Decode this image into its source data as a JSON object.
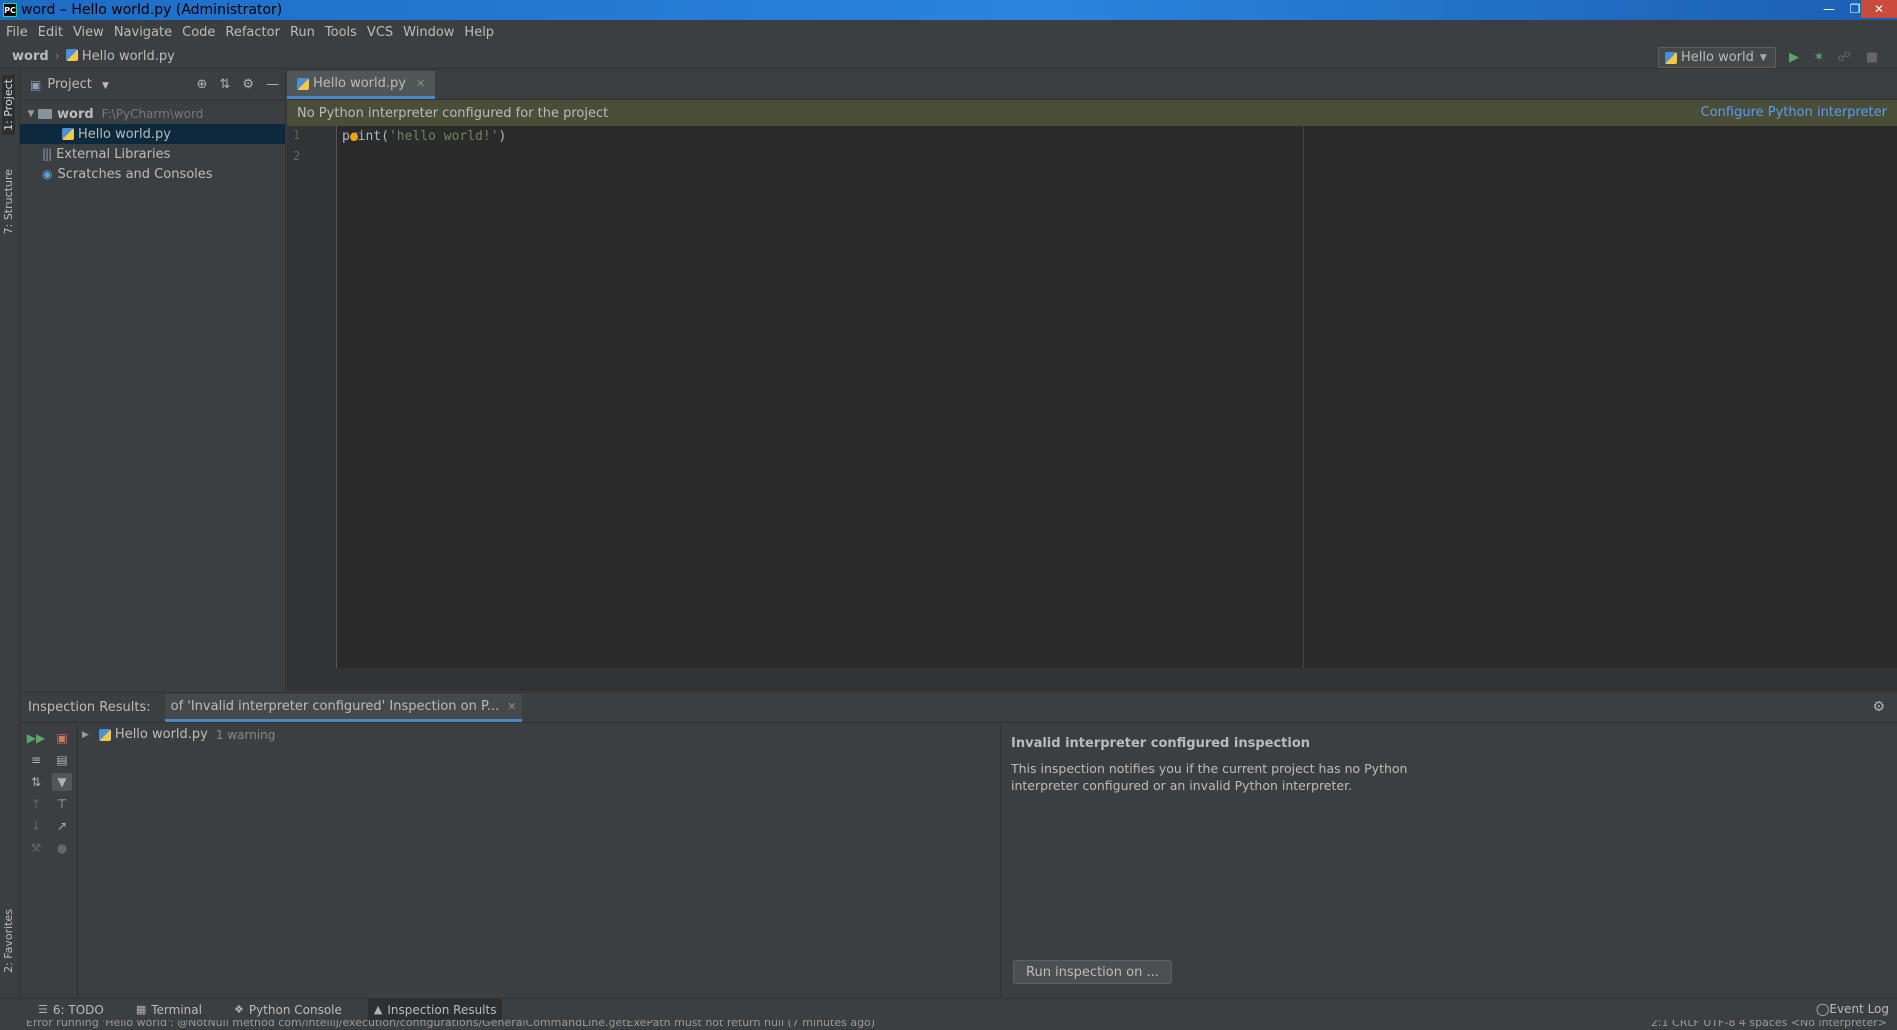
{
  "window": {
    "title": "word – Hello world.py (Administrator)",
    "app_icon": "PC"
  },
  "menu": [
    "File",
    "Edit",
    "View",
    "Navigate",
    "Code",
    "Refactor",
    "Run",
    "Tools",
    "VCS",
    "Window",
    "Help"
  ],
  "navbar": {
    "root": "word",
    "file": "Hello world.py"
  },
  "run_config": {
    "label": "Hello world"
  },
  "left_strip": {
    "project_tab": "1: Project",
    "structure_tab": "7: Structure",
    "favorites_tab": "2: Favorites"
  },
  "project_panel": {
    "title": "Project",
    "root_name": "word",
    "root_path": "F:\\PyCharm\\word",
    "file": "Hello world.py",
    "external_libraries": "External Libraries",
    "scratches": "Scratches and Consoles"
  },
  "editor": {
    "tab_label": "Hello world.py",
    "notification": "No Python interpreter configured for the project",
    "notification_link": "Configure Python interpreter",
    "line1_no": "1",
    "line2_no": "2",
    "code_fn": "print(",
    "code_str": "'hello world!'",
    "code_close": ")"
  },
  "inspection": {
    "label": "Inspection Results:",
    "tab": "of 'Invalid interpreter configured' Inspection on P...",
    "tree_file": "Hello world.py",
    "warning_count": "1 warning",
    "detail_title": "Invalid interpreter configured inspection",
    "detail_text": "This inspection notifies you if the current project has no Python interpreter configured or an invalid Python interpreter.",
    "run_button": "Run inspection on ..."
  },
  "bottom_tabs": {
    "todo": "6: TODO",
    "terminal": "Terminal",
    "python_console": "Python Console",
    "inspection_results": "Inspection Results",
    "event_log": "Event Log"
  },
  "statusbar": {
    "message": "Error running 'Hello world': @NotNull method com/intellij/execution/configurations/GeneralCommandLine.getExePath must not return null (7 minutes ago)",
    "right": "2:1   CRLF   UTF-8   4 spaces   <No interpreter>"
  },
  "colors": {
    "accent": "#4a88c7",
    "link": "#589df6",
    "notification_bg": "#4a4d37",
    "editor_bg": "#2b2b2b",
    "run_green": "#59a869"
  }
}
